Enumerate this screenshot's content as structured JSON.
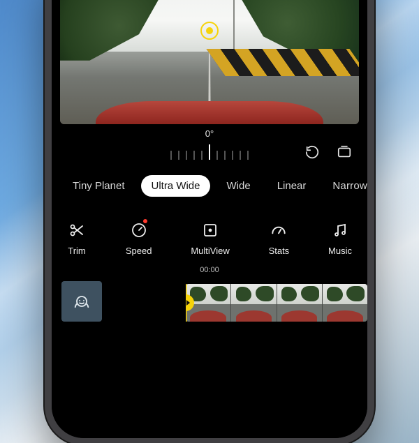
{
  "angle": {
    "value": "0°"
  },
  "view_modes": [
    {
      "label": "Tiny Planet",
      "active": false
    },
    {
      "label": "Ultra Wide",
      "active": true
    },
    {
      "label": "Wide",
      "active": false
    },
    {
      "label": "Linear",
      "active": false
    },
    {
      "label": "Narrow",
      "active": false
    }
  ],
  "tools": {
    "trim": {
      "label": "Trim"
    },
    "speed": {
      "label": "Speed"
    },
    "multiview": {
      "label": "MultiView"
    },
    "stats": {
      "label": "Stats"
    },
    "music": {
      "label": "Music"
    }
  },
  "timeline": {
    "timecode": "00:00"
  }
}
